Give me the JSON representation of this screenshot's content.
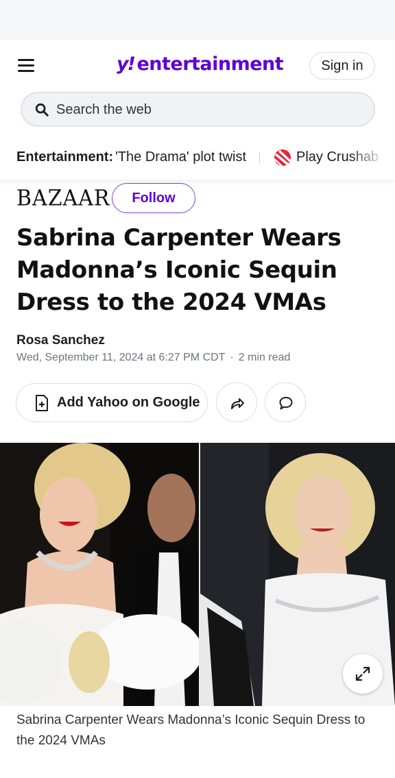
{
  "header": {
    "brand_prefix": "y",
    "brand_bang": "!",
    "brand_suffix": "entertainment",
    "signin_label": "Sign in"
  },
  "search": {
    "placeholder": "Search the web"
  },
  "trending": {
    "label": "Entertainment:",
    "story": "'The Drama' plot twist",
    "game": "Play Crushab"
  },
  "publisher": {
    "name": "BAZAAR",
    "follow_label": "Follow"
  },
  "article": {
    "headline": "Sabrina Carpenter Wears Madonna’s Iconic Sequin Dress to the 2024 VMAs",
    "author": "Rosa Sanchez",
    "date": "Wed, September 11, 2024 at 6:27 PM CDT",
    "separator": "·",
    "read_time": "2 min read",
    "caption": "Sabrina Carpenter Wears Madonna’s Iconic Sequin Dress to the 2024 VMAs"
  },
  "actions": {
    "add_google_label": "Add Yahoo on Google",
    "share_icon": "share-icon",
    "comment_icon": "comment-icon"
  },
  "colors": {
    "brand_purple": "#6001d2",
    "text_dark": "#111111",
    "meta_gray": "#6e7280"
  }
}
